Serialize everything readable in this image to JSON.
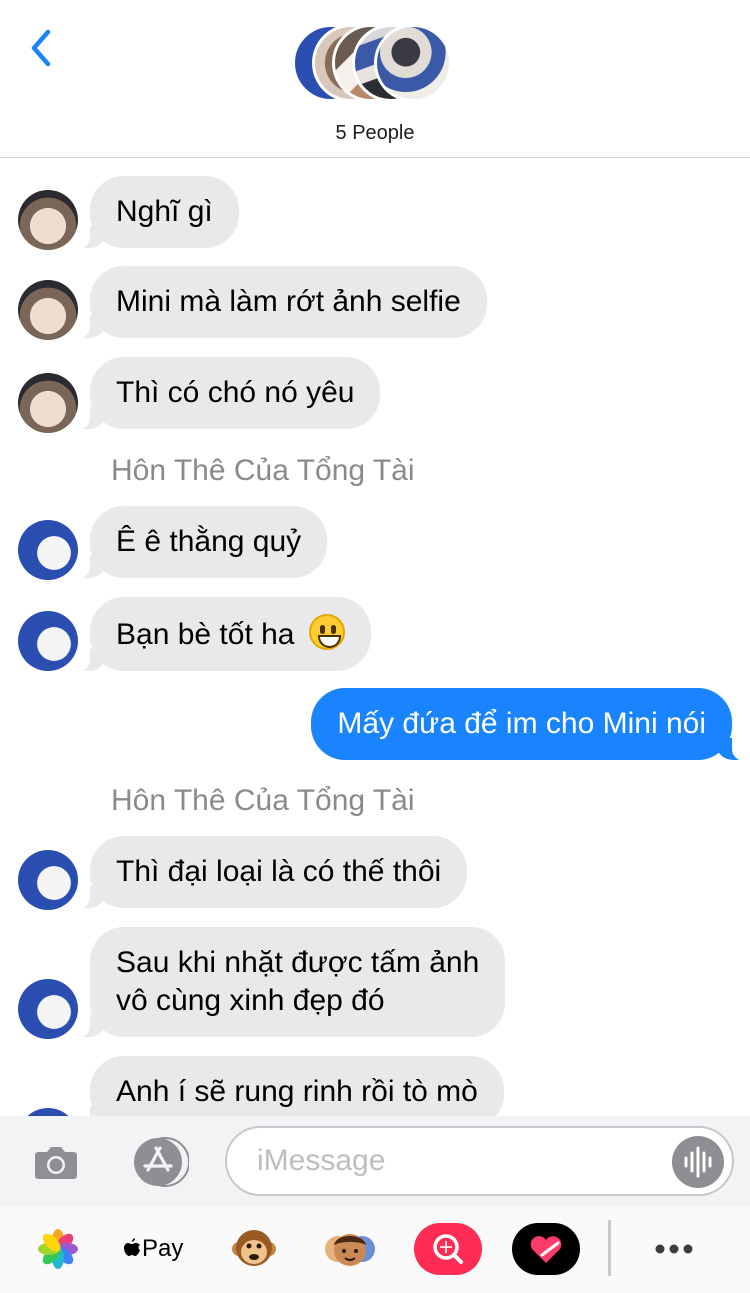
{
  "header": {
    "back_icon": "chevron-left-icon",
    "group_name": "5 People",
    "accent_color": "#1a84ff"
  },
  "messages": [
    {
      "type": "in",
      "avatar": "user-a",
      "text": "Nghĩ gì"
    },
    {
      "type": "in",
      "avatar": "user-a",
      "text": "Mini mà làm rớt ảnh selfie"
    },
    {
      "type": "in",
      "avatar": "user-a",
      "text": "Thì có chó nó yêu"
    },
    {
      "type": "sender",
      "text": "Hôn Thê Của Tổng Tài"
    },
    {
      "type": "in",
      "avatar": "user-b",
      "text": "Ê ê thằng quỷ"
    },
    {
      "type": "in",
      "avatar": "user-b",
      "text": "Bạn bè tốt ha",
      "emoji": "grinning-face"
    },
    {
      "type": "out",
      "text": "Mấy đứa để im cho Mini nói"
    },
    {
      "type": "sender",
      "text": "Hôn Thê Của Tổng Tài"
    },
    {
      "type": "in",
      "avatar": "user-b",
      "text": "Thì đại loại là có thế thôi"
    },
    {
      "type": "in",
      "avatar": "user-b",
      "lines": [
        "Sau khi nhặt được tấm ảnh",
        "vô cùng xinh đẹp đó"
      ]
    },
    {
      "type": "in",
      "avatar": "user-b",
      "text": "Anh í sẽ rung rinh rồi tò mò"
    }
  ],
  "input_bar": {
    "camera_icon": "camera-icon",
    "appstore_icon": "app-store-icon",
    "placeholder": "iMessage",
    "audio_icon": "audio-waveform-icon"
  },
  "app_strip": {
    "items": [
      "photos-icon",
      "Pay",
      "monkey-animoji-icon",
      "memoji-icon",
      "image-search-icon",
      "digital-touch-icon",
      "more-icon"
    ],
    "apple_pay_label": "Pay"
  }
}
